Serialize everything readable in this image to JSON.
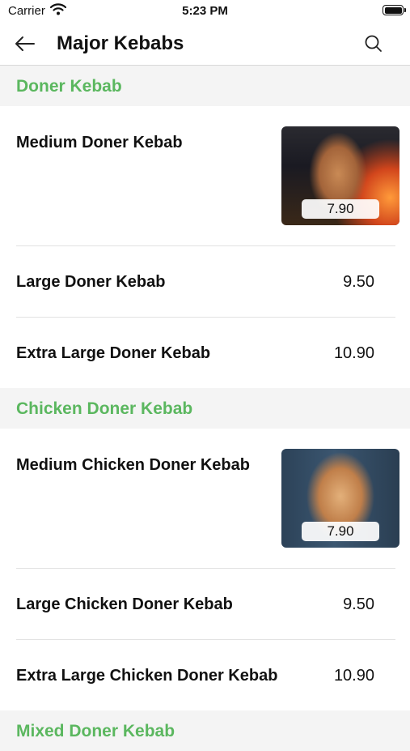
{
  "status_bar": {
    "carrier": "Carrier",
    "time": "5:23 PM"
  },
  "nav": {
    "title": "Major Kebabs",
    "back_icon": "arrow-left-icon",
    "search_icon": "search-icon"
  },
  "sections": [
    {
      "title": "Doner Kebab",
      "items": [
        {
          "name": "Medium Doner Kebab",
          "price": "7.90",
          "image": "doner-kebab-photo"
        },
        {
          "name": "Large Doner Kebab",
          "price": "9.50"
        },
        {
          "name": "Extra Large Doner Kebab",
          "price": "10.90"
        }
      ]
    },
    {
      "title": "Chicken Doner Kebab",
      "items": [
        {
          "name": "Medium Chicken Doner Kebab",
          "price": "7.90",
          "image": "chicken-doner-kebab-photo"
        },
        {
          "name": "Large Chicken Doner Kebab",
          "price": "9.50"
        },
        {
          "name": "Extra Large Chicken Doner Kebab",
          "price": "10.90"
        }
      ]
    },
    {
      "title": "Mixed Doner Kebab",
      "items": []
    }
  ],
  "colors": {
    "accent_green": "#5bb75f",
    "section_bg": "#f4f4f4",
    "divider": "#e2e2e2"
  }
}
